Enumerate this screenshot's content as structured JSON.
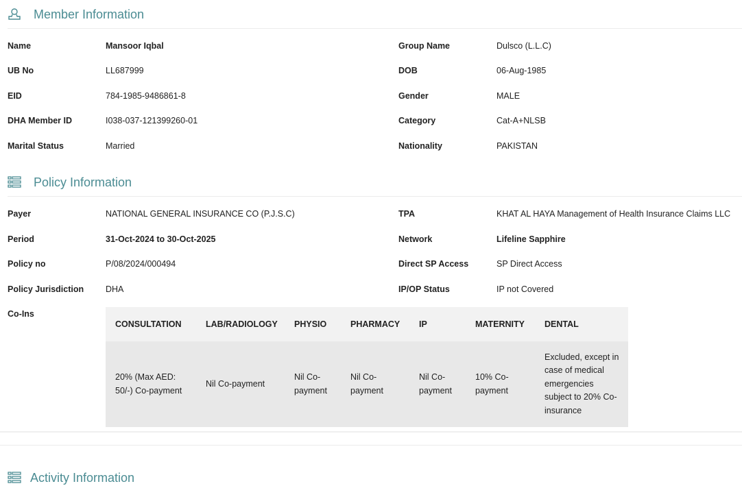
{
  "member": {
    "title": "Member Information",
    "icon": "user-icon",
    "rows": [
      {
        "l1": "Name",
        "v1": "Mansoor Iqbal",
        "l2": "Group Name",
        "v2": "Dulsco (L.L.C)"
      },
      {
        "l1": "UB No",
        "v1": "LL687999",
        "l2": "DOB",
        "v2": "06-Aug-1985"
      },
      {
        "l1": "EID",
        "v1": "784-1985-9486861-8",
        "l2": "Gender",
        "v2": "MALE"
      },
      {
        "l1": "DHA Member ID",
        "v1": "I038-037-121399260-01",
        "l2": "Category",
        "v2": "Cat-A+NLSB"
      },
      {
        "l1": "Marital Status",
        "v1": "Married",
        "l2": "Nationality",
        "v2": "PAKISTAN"
      }
    ]
  },
  "policy": {
    "title": "Policy Information",
    "icon": "list-icon",
    "rows": [
      {
        "l1": "Payer",
        "v1": "NATIONAL GENERAL INSURANCE CO (P.J.S.C)",
        "l2": "TPA",
        "v2": "KHAT AL HAYA Management of Health Insurance Claims LLC"
      },
      {
        "l1": "Period",
        "v1": "31-Oct-2024 to 30-Oct-2025",
        "l2": "Network",
        "v2": "Lifeline Sapphire"
      },
      {
        "l1": "Policy no",
        "v1": "P/08/2024/000494",
        "l2": "Direct SP Access",
        "v2": "SP Direct Access"
      },
      {
        "l1": "Policy Jurisdiction",
        "v1": "DHA",
        "l2": "IP/OP Status",
        "v2": "IP not Covered"
      }
    ],
    "coins_label": "Co-Ins",
    "coins": {
      "headers": [
        "CONSULTATION",
        "LAB/RADIOLOGY",
        "PHYSIO",
        "PHARMACY",
        "IP",
        "MATERNITY",
        "DENTAL"
      ],
      "values": [
        "20% (Max AED: 50/-) Co-payment",
        "Nil Co-payment",
        "Nil Co-payment",
        "Nil Co-payment",
        "Nil Co-payment",
        "10% Co-payment",
        "Excluded, except in case of medical emergencies subject to 20% Co-insurance"
      ]
    }
  },
  "activity": {
    "title": "Activity Information",
    "icon": "list-icon"
  }
}
